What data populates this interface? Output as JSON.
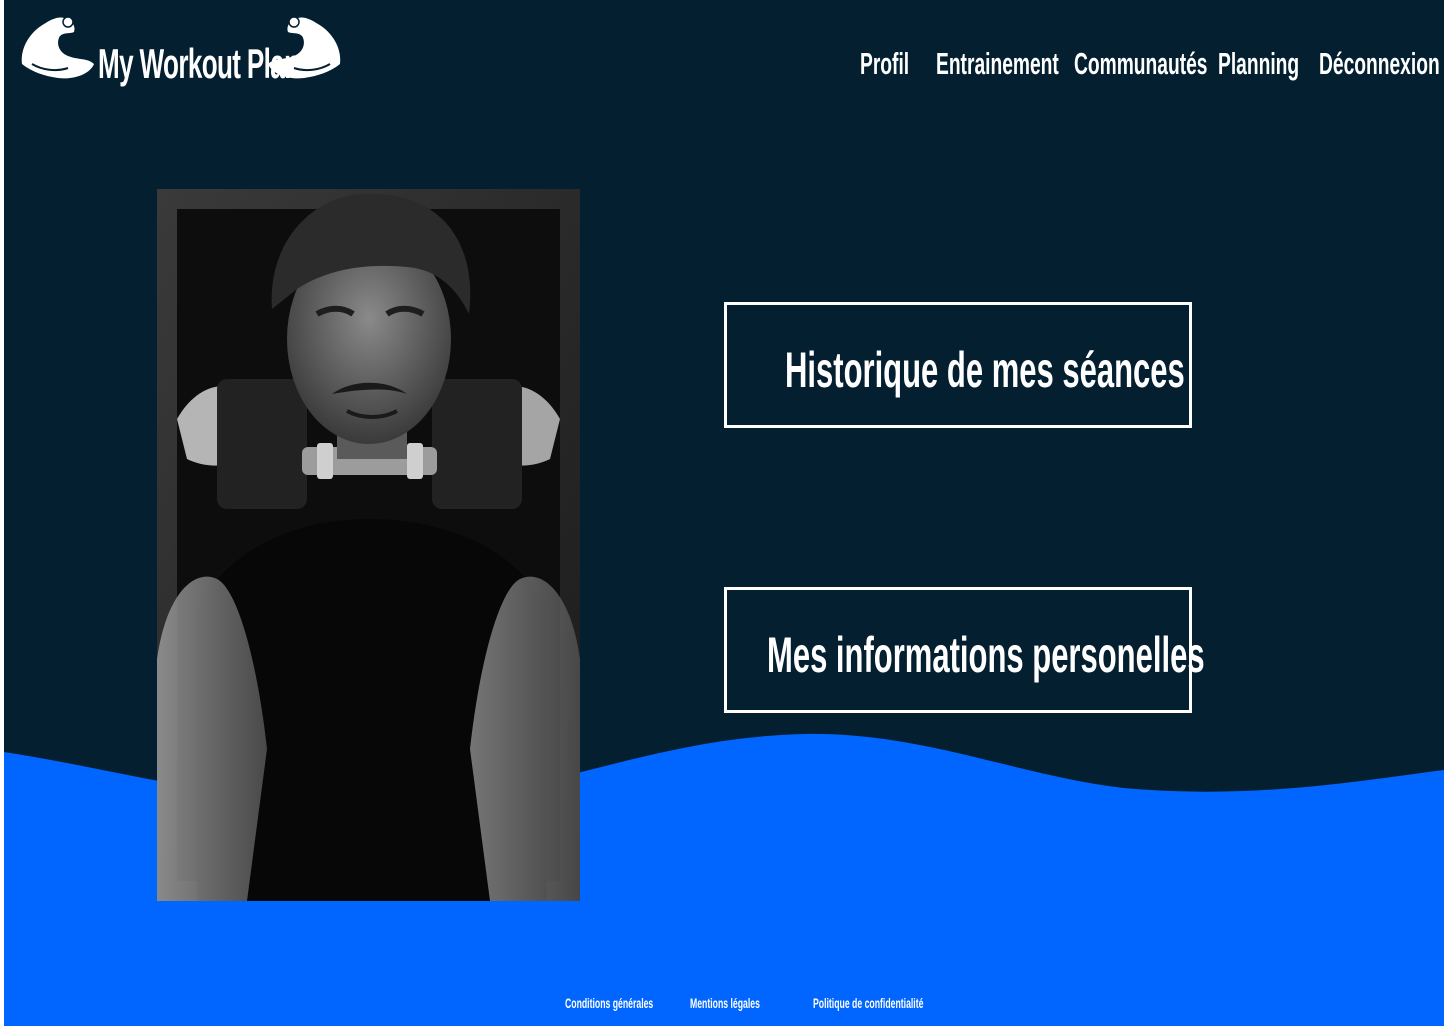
{
  "colors": {
    "background": "#031f30",
    "wave": "#0066ff",
    "text": "#ffffff"
  },
  "logo": {
    "brand": "My Workout Plan",
    "icon": "flexed-arm-icon"
  },
  "nav": {
    "items": [
      {
        "label": "Profil"
      },
      {
        "label": "Entrainement"
      },
      {
        "label": "Communautés"
      },
      {
        "label": "Planning"
      },
      {
        "label": "Déconnexion"
      }
    ]
  },
  "main": {
    "photo_alt": "man-lifting-dumbbell",
    "buttons": [
      {
        "label": "Historique de mes séances"
      },
      {
        "label": "Mes informations personelles"
      }
    ]
  },
  "footer": {
    "links": [
      {
        "label": "Conditions générales"
      },
      {
        "label": "Mentions légales"
      },
      {
        "label": "Politique de confidentialité"
      }
    ]
  }
}
